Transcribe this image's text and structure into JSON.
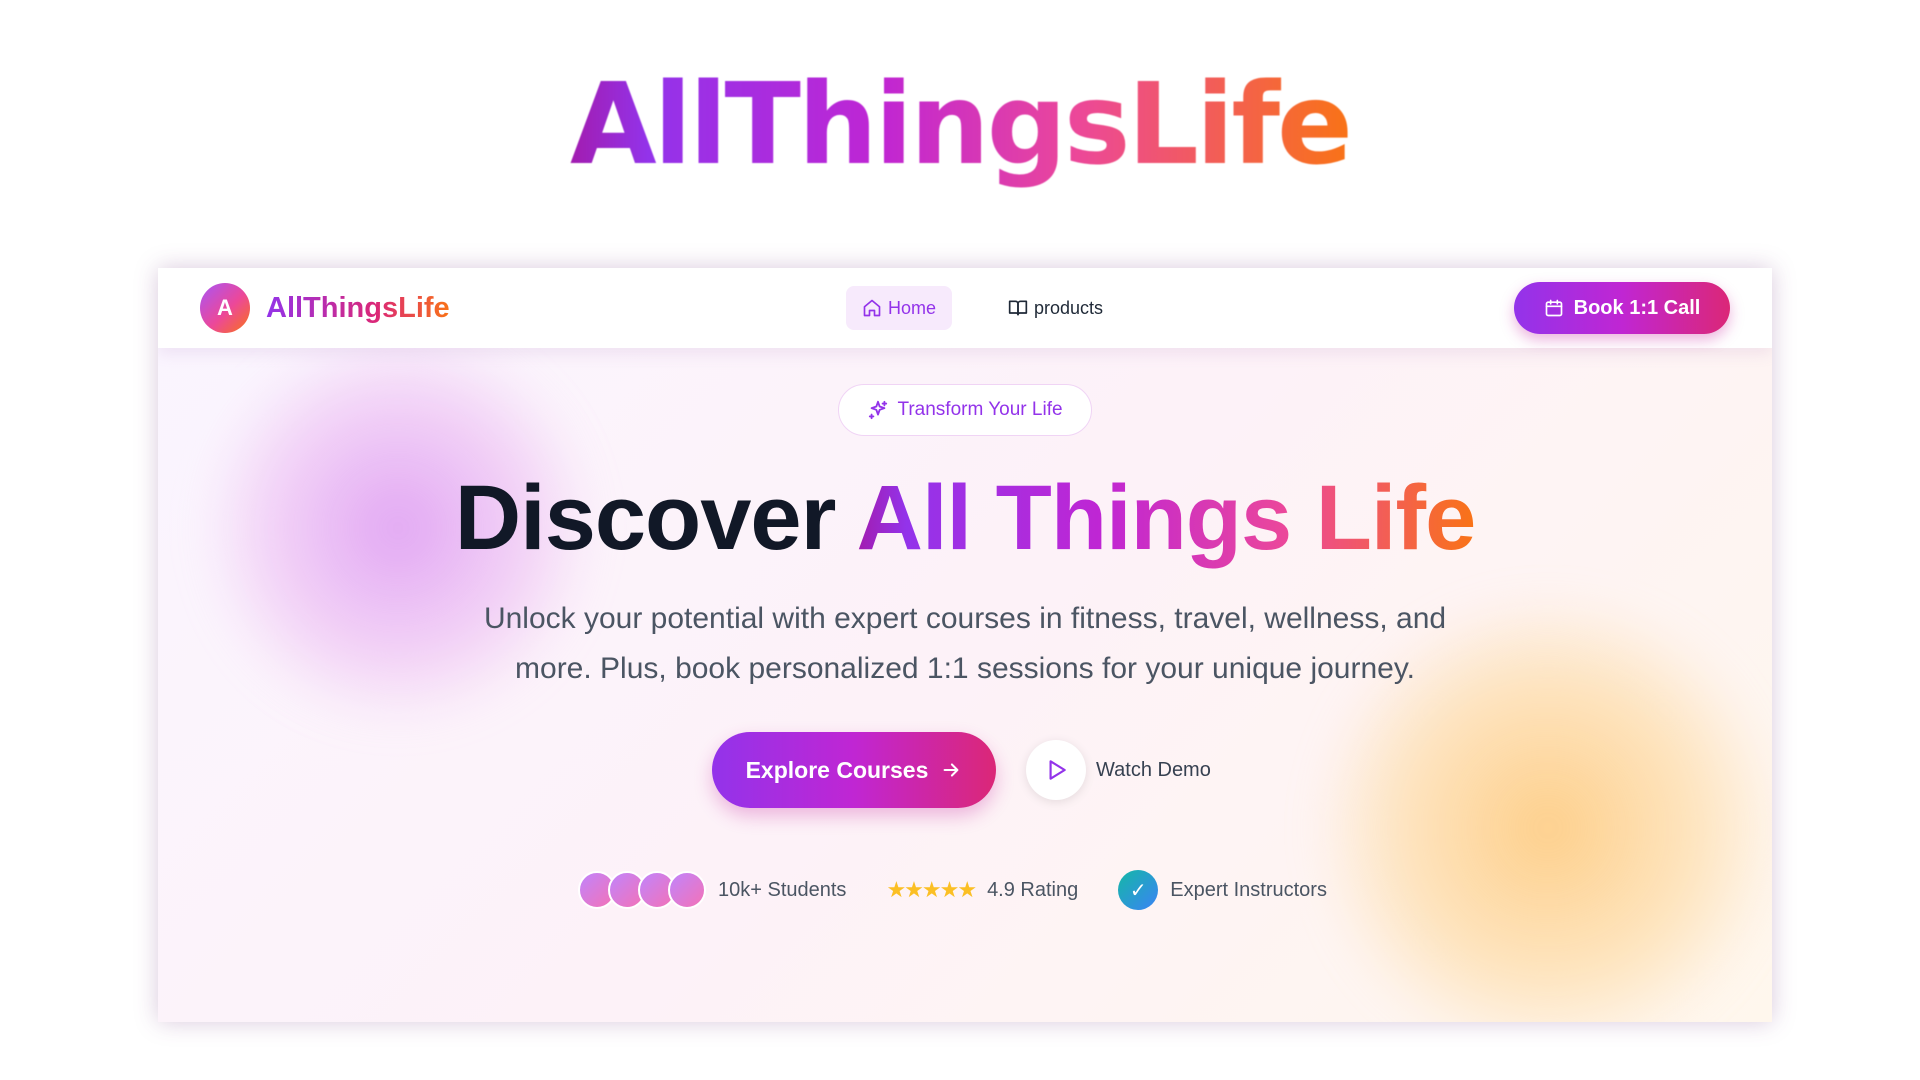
{
  "top_logo": {
    "text": "AllThingsLife"
  },
  "navbar": {
    "brand": {
      "avatar_letter": "A",
      "name": "AllThingsLife"
    },
    "links": [
      {
        "label": "Home",
        "icon": "home-icon",
        "active": true
      },
      {
        "label": "products",
        "icon": "book-open-icon",
        "active": false
      }
    ],
    "cta": {
      "label": "Book 1:1 Call",
      "icon": "calendar-icon"
    }
  },
  "hero": {
    "pill": {
      "label": "Transform Your Life",
      "icon": "sparkles-icon"
    },
    "headline": {
      "plain": "Discover ",
      "gradient": "All Things Life"
    },
    "subtext": "Unlock your potential with expert courses in fitness, travel, wellness, and more. Plus, book personalized 1:1 sessions for your unique journey.",
    "primary_button": {
      "label": "Explore Courses",
      "icon": "arrow-right-icon"
    },
    "secondary_button": {
      "label": "Watch Demo",
      "icon": "play-icon"
    }
  },
  "stats": {
    "students": {
      "label": "10k+ Students"
    },
    "rating": {
      "stars": "★★★★★",
      "label": "4.9 Rating"
    },
    "instructors": {
      "check": "✓",
      "label": "Expert Instructors"
    }
  },
  "colors": {
    "accent_purple": "#9333ea",
    "accent_pink": "#db2777",
    "accent_orange": "#f97316",
    "text_dark": "#111827",
    "star_yellow": "#fbbf24"
  }
}
